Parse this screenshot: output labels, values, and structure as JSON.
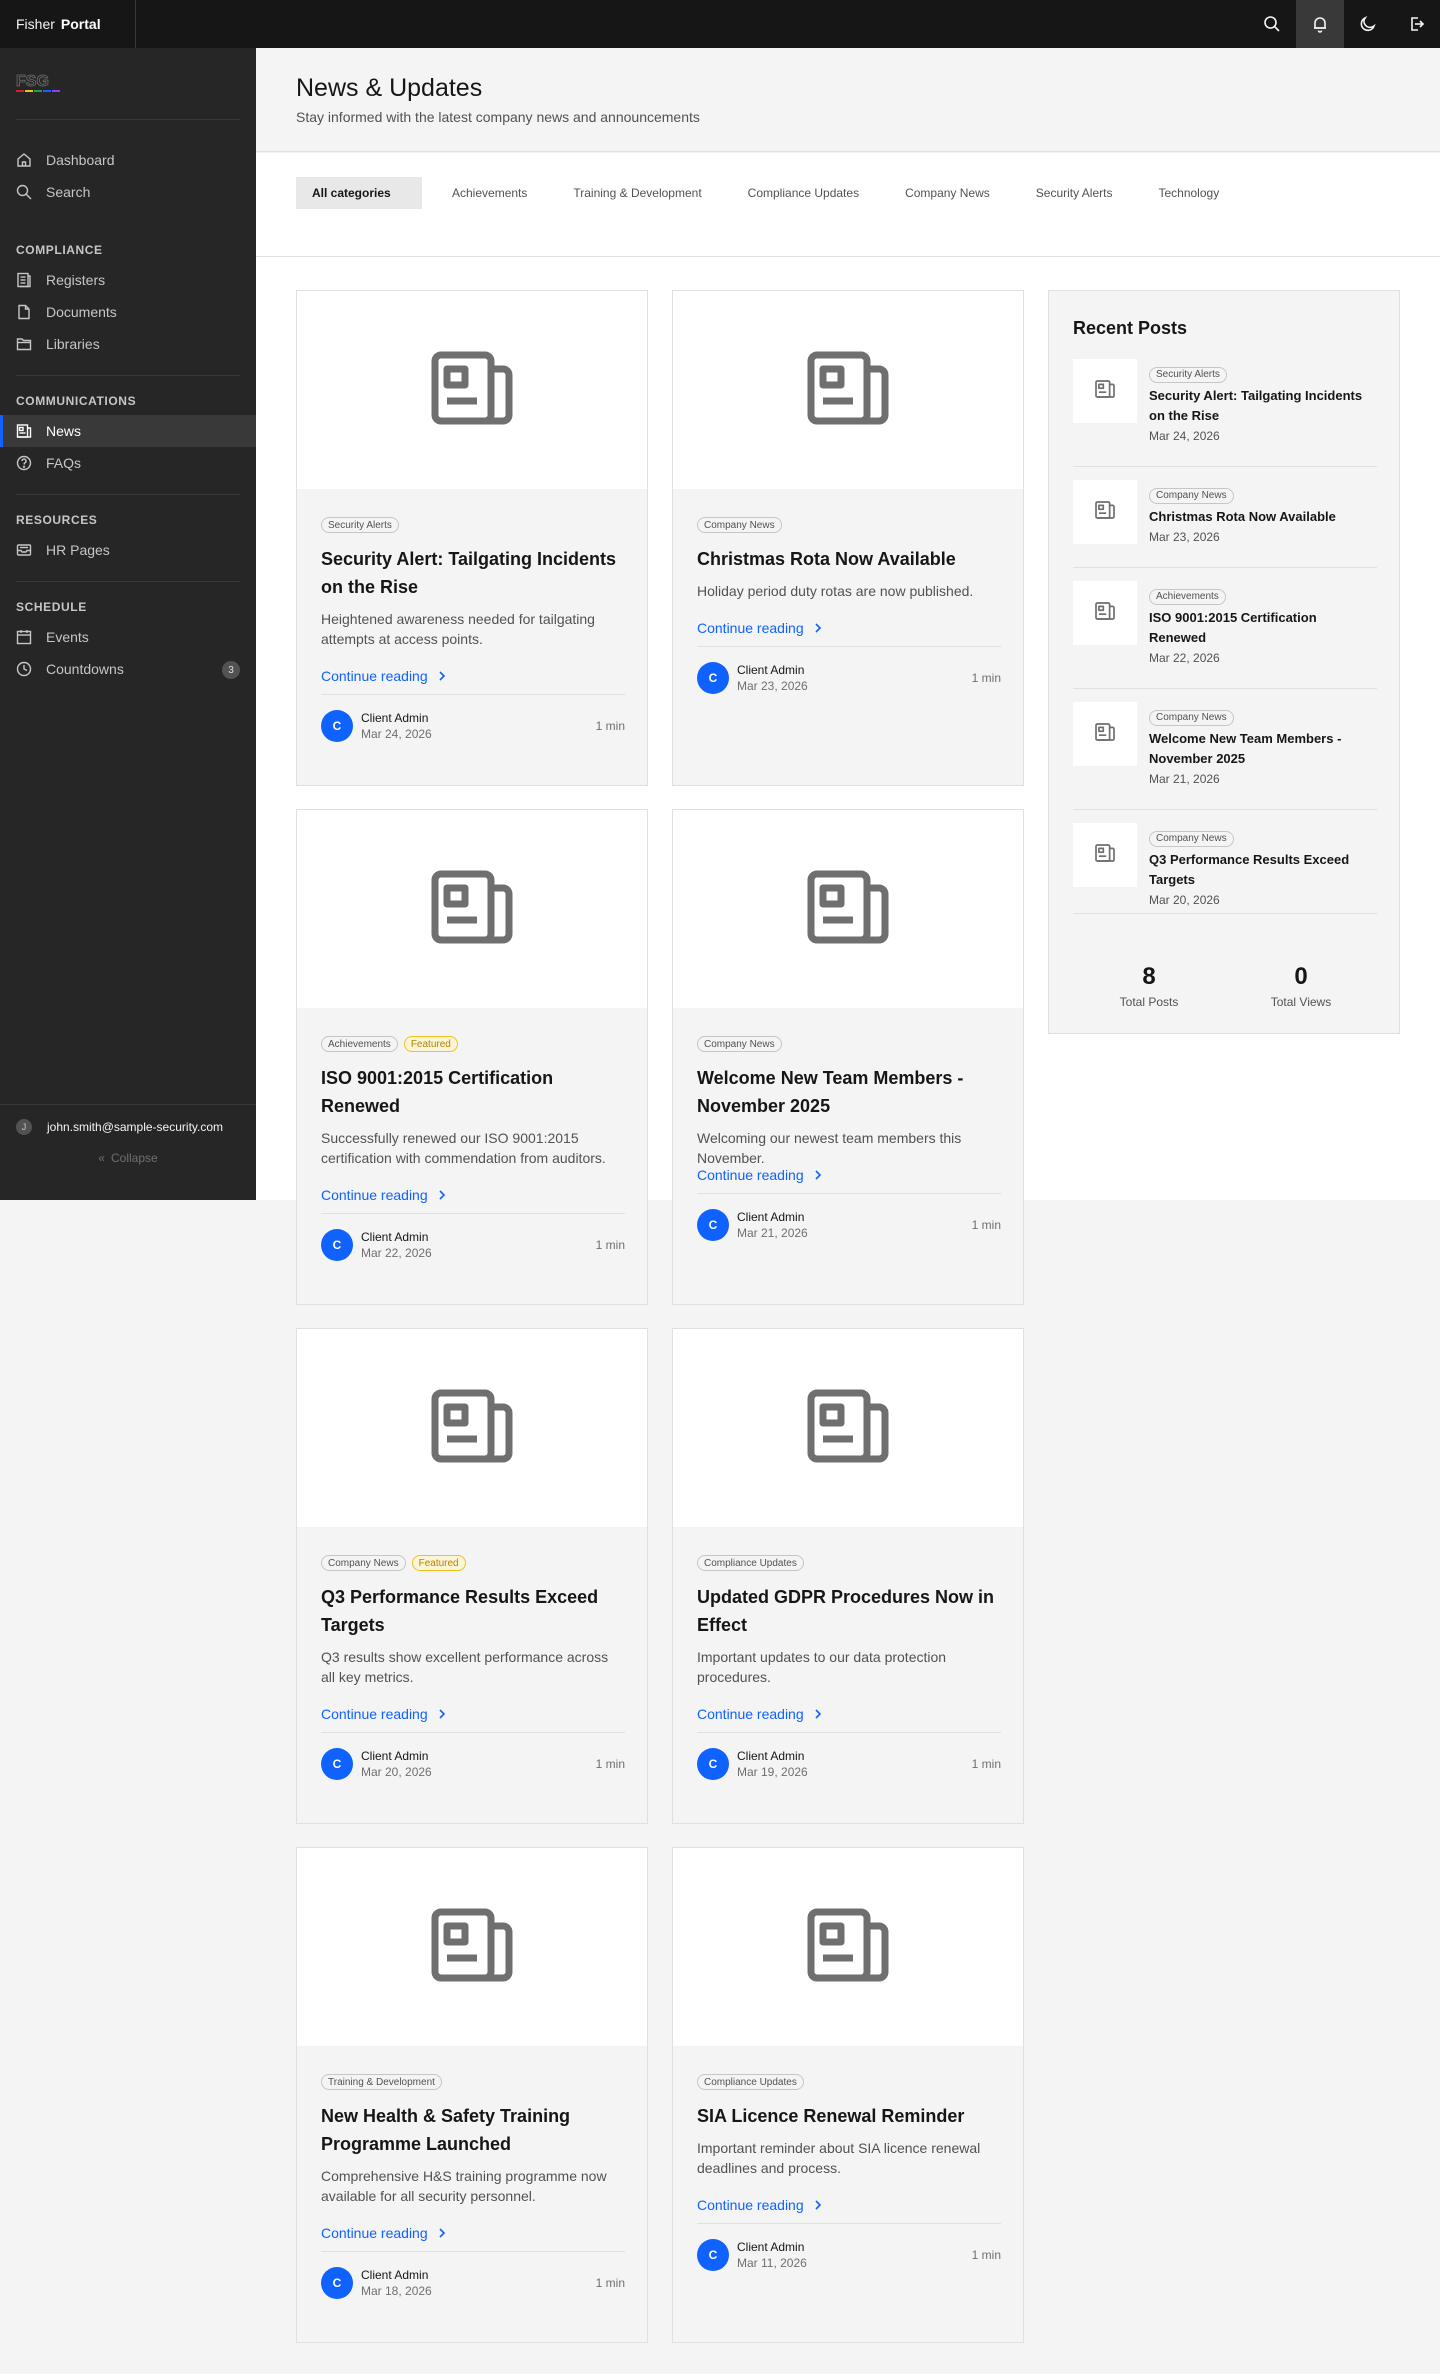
{
  "app": {
    "brand_first": "Fisher",
    "brand_second": "Portal"
  },
  "topbar": {
    "icons": [
      "search-icon",
      "notification-icon",
      "moon-icon",
      "logout-icon"
    ]
  },
  "sidebar": {
    "main": [
      {
        "label": "Dashboard",
        "icon": "home-icon"
      },
      {
        "label": "Search",
        "icon": "search-icon"
      }
    ],
    "compliance_heading": "COMPLIANCE",
    "compliance": [
      {
        "label": "Registers",
        "icon": "registers-icon"
      },
      {
        "label": "Documents",
        "icon": "document-icon"
      },
      {
        "label": "Libraries",
        "icon": "folder-icon"
      }
    ],
    "communications_heading": "COMMUNICATIONS",
    "communications": [
      {
        "label": "News",
        "icon": "news-icon",
        "active": true
      },
      {
        "label": "FAQs",
        "icon": "help-icon"
      }
    ],
    "resources_heading": "RESOURCES",
    "resources": [
      {
        "label": "HR Pages",
        "icon": "inbox-icon"
      }
    ],
    "schedule_heading": "SCHEDULE",
    "schedule": [
      {
        "label": "Events",
        "icon": "calendar-icon"
      },
      {
        "label": "Countdowns",
        "icon": "clock-icon",
        "badge": "3"
      }
    ],
    "user_initial": "J",
    "user_email": "john.smith@sample-security.com",
    "collapse_label": "Collapse"
  },
  "header": {
    "title": "News & Updates",
    "subtitle": "Stay informed with the latest company news and announcements"
  },
  "tabs": [
    "All categories",
    "Achievements",
    "Training & Development",
    "Compliance Updates",
    "Company News",
    "Security Alerts",
    "Technology"
  ],
  "cards": [
    {
      "tags": [
        "Security Alerts"
      ],
      "featured": "",
      "title": "Security Alert: Tailgating Incidents on the Rise",
      "desc": "Heightened awareness needed for tailgating attempts at access points.",
      "link": "Continue reading",
      "initial": "C",
      "author": "Client Admin",
      "date": "Mar 24, 2026",
      "read": "1 min"
    },
    {
      "tags": [
        "Company News"
      ],
      "featured": "",
      "title": "Christmas Rota Now Available",
      "desc": "Holiday period duty rotas are now published.",
      "link": "Continue reading",
      "initial": "C",
      "author": "Client Admin",
      "date": "Mar 23, 2026",
      "read": "1 min"
    },
    {
      "tags": [
        "Achievements"
      ],
      "featured": "Featured",
      "title": "ISO 9001:2015 Certification Renewed",
      "desc": "Successfully renewed our ISO 9001:2015 certification with commendation from auditors.",
      "link": "Continue reading",
      "initial": "C",
      "author": "Client Admin",
      "date": "Mar 22, 2026",
      "read": "1 min"
    },
    {
      "tags": [
        "Company News"
      ],
      "featured": "",
      "title": "Welcome New Team Members - November 2025",
      "desc": "Welcoming our newest team members this November.",
      "link": "Continue reading",
      "initial": "C",
      "author": "Client Admin",
      "date": "Mar 21, 2026",
      "read": "1 min"
    },
    {
      "tags": [
        "Company News"
      ],
      "featured": "Featured",
      "title": "Q3 Performance Results Exceed Targets",
      "desc": "Q3 results show excellent performance across all key metrics.",
      "link": "Continue reading",
      "initial": "C",
      "author": "Client Admin",
      "date": "Mar 20, 2026",
      "read": "1 min"
    },
    {
      "tags": [
        "Compliance Updates"
      ],
      "featured": "",
      "title": "Updated GDPR Procedures Now in Effect",
      "desc": "Important updates to our data protection procedures.",
      "link": "Continue reading",
      "initial": "C",
      "author": "Client Admin",
      "date": "Mar 19, 2026",
      "read": "1 min"
    },
    {
      "tags": [
        "Training & Development"
      ],
      "featured": "",
      "title": "New Health & Safety Training Programme Launched",
      "desc": "Comprehensive H&S training programme now available for all security personnel.",
      "link": "Continue reading",
      "initial": "C",
      "author": "Client Admin",
      "date": "Mar 18, 2026",
      "read": "1 min"
    },
    {
      "tags": [
        "Compliance Updates"
      ],
      "featured": "",
      "title": "SIA Licence Renewal Reminder",
      "desc": "Important reminder about SIA licence renewal deadlines and process.",
      "link": "Continue reading",
      "initial": "C",
      "author": "Client Admin",
      "date": "Mar 11, 2026",
      "read": "1 min"
    }
  ],
  "recent": {
    "title": "Recent Posts",
    "items": [
      {
        "tag": "Security Alerts",
        "title": "Security Alert: Tailgating Incidents on the Rise",
        "date": "Mar 24, 2026"
      },
      {
        "tag": "Company News",
        "title": "Christmas Rota Now Available",
        "date": "Mar 23, 2026"
      },
      {
        "tag": "Achievements",
        "title": "ISO 9001:2015 Certification Renewed",
        "date": "Mar 22, 2026"
      },
      {
        "tag": "Company News",
        "title": "Welcome New Team Members - November 2025",
        "date": "Mar 21, 2026"
      },
      {
        "tag": "Company News",
        "title": "Q3 Performance Results Exceed Targets",
        "date": "Mar 20, 2026"
      }
    ],
    "total_posts": "8",
    "total_posts_label": "Total Posts",
    "total_views": "0",
    "total_views_label": "Total Views"
  },
  "colors": {
    "accent": "#0f62fe",
    "sidebar": "#262626",
    "topbar": "#161616",
    "featured": "#f1c21b"
  }
}
